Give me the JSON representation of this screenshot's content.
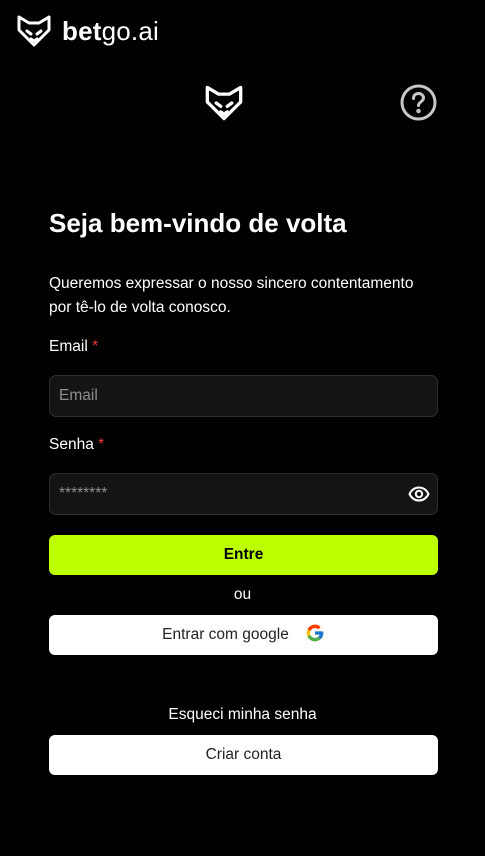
{
  "header": {
    "brand_bold": "bet",
    "brand_rest": "go.ai"
  },
  "login": {
    "title": "Seja bem-vindo de volta",
    "subtitle": "Queremos expressar o nosso sincero contentamento por tê-lo de volta conosco.",
    "email_label": "Email",
    "email_placeholder": "Email",
    "email_value": "",
    "password_label": "Senha",
    "password_placeholder": "********",
    "password_value": "",
    "required_mark": "*",
    "submit_label": "Entre",
    "or_text": "ou",
    "google_label": "Entrar com google",
    "forgot_label": "Esqueci minha senha",
    "create_label": "Criar conta"
  },
  "colors": {
    "accent": "#bbff00",
    "background": "#000000",
    "input_bg": "#141414",
    "required": "#e53935"
  },
  "icons": {
    "brand_logo": "fox-shield-icon",
    "center_logo": "fox-shield-icon",
    "help": "question-circle-icon",
    "toggle_password": "eye-icon",
    "google": "google-g-icon"
  }
}
